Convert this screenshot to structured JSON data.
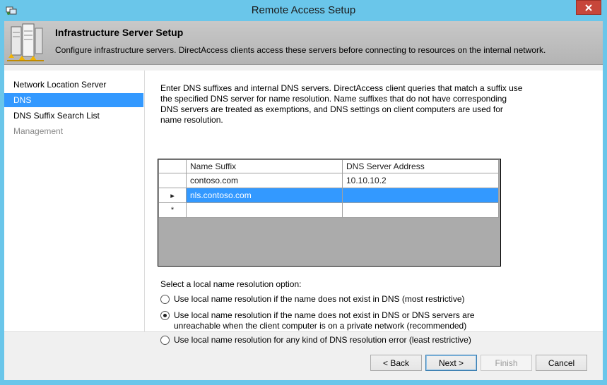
{
  "window": {
    "title": "Remote Access Setup"
  },
  "header": {
    "title": "Infrastructure Server Setup",
    "description": "Configure infrastructure servers. DirectAccess clients access these servers before connecting to resources on the internal network."
  },
  "nav": {
    "items": [
      {
        "label": "Network Location Server",
        "state": "normal"
      },
      {
        "label": "DNS",
        "state": "selected"
      },
      {
        "label": "DNS Suffix Search List",
        "state": "normal"
      },
      {
        "label": "Management",
        "state": "disabled"
      }
    ]
  },
  "content": {
    "intro": "Enter DNS suffixes and internal DNS servers.  DirectAccess client queries that match a suffix use the specified DNS server for name resolution. Name suffixes that do not have corresponding DNS servers are treated as exemptions, and DNS settings on client computers are used for name resolution.",
    "table": {
      "headers": [
        "Name Suffix",
        "DNS Server Address"
      ],
      "rows": [
        {
          "marker": "",
          "name_suffix": "contoso.com",
          "dns_server": "10.10.10.2"
        },
        {
          "marker": "▸",
          "name_suffix": "nls.contoso.com",
          "dns_server": ""
        },
        {
          "marker": "*",
          "name_suffix": "",
          "dns_server": ""
        }
      ]
    },
    "option_label": "Select a local name resolution option:",
    "options": [
      {
        "label": "Use local name resolution if the name does not exist in DNS (most restrictive)",
        "checked": false
      },
      {
        "label": "Use local name resolution if the name does not exist in DNS or DNS servers are unreachable when the client computer is on a private network (recommended)",
        "checked": true
      },
      {
        "label": "Use local name resolution for any kind of DNS resolution error (least restrictive)",
        "checked": false
      }
    ]
  },
  "buttons": {
    "back": "< Back",
    "next": "Next >",
    "finish": "Finish",
    "cancel": "Cancel"
  },
  "colors": {
    "titlebar": "#6ac6ea",
    "selection": "#3399ff",
    "close": "#c7463a"
  }
}
